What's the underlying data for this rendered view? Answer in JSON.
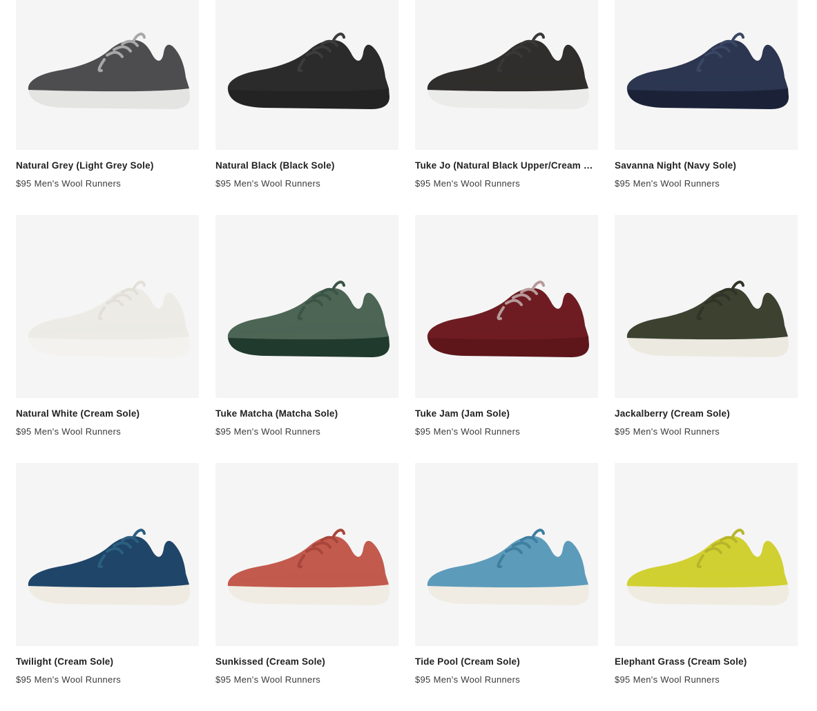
{
  "products": [
    {
      "name": "Natural Grey (Light Grey Sole)",
      "price": "$95",
      "line": "Men's Wool Runners",
      "upper": "#4d4d4f",
      "sole": "#e4e4e2",
      "lace": "#a8a8a8",
      "icon": "shoe-icon"
    },
    {
      "name": "Natural Black (Black Sole)",
      "price": "$95",
      "line": "Men's Wool Runners",
      "upper": "#2b2b2c",
      "sole": "#232323",
      "lace": "#3c3c3c",
      "icon": "shoe-icon"
    },
    {
      "name": "Tuke Jo (Natural Black Upper/Cream Sole)",
      "price": "$95",
      "line": "Men's Wool Runners",
      "upper": "#302e2c",
      "sole": "#ebebe9",
      "lace": "#3a3836",
      "icon": "shoe-icon"
    },
    {
      "name": "Savanna Night (Navy Sole)",
      "price": "$95",
      "line": "Men's Wool Runners",
      "upper": "#2c3650",
      "sole": "#1b2238",
      "lace": "#3a4663",
      "icon": "shoe-icon"
    },
    {
      "name": "Natural White (Cream Sole)",
      "price": "$95",
      "line": "Men's Wool Runners",
      "upper": "#ecebe6",
      "sole": "#f3f2ee",
      "lace": "#e1dfd8",
      "icon": "shoe-icon"
    },
    {
      "name": "Tuke Matcha (Matcha Sole)",
      "price": "$95",
      "line": "Men's Wool Runners",
      "upper": "#4c6555",
      "sole": "#213a2e",
      "lace": "#3a5446",
      "icon": "shoe-icon"
    },
    {
      "name": "Tuke Jam (Jam Sole)",
      "price": "$95",
      "line": "Men's Wool Runners",
      "upper": "#6e1c22",
      "sole": "#5e161b",
      "lace": "#b79a9a",
      "icon": "shoe-icon"
    },
    {
      "name": "Jackalberry (Cream Sole)",
      "price": "$95",
      "line": "Men's Wool Runners",
      "upper": "#3c4130",
      "sole": "#ece9e0",
      "lace": "#2f3427",
      "icon": "shoe-icon"
    },
    {
      "name": "Twilight (Cream Sole)",
      "price": "$95",
      "line": "Men's Wool Runners",
      "upper": "#1f4569",
      "sole": "#efebe2",
      "lace": "#2b5f80",
      "icon": "shoe-icon"
    },
    {
      "name": "Sunkissed (Cream Sole)",
      "price": "$95",
      "line": "Men's Wool Runners",
      "upper": "#c25a4d",
      "sole": "#f0ece3",
      "lace": "#a8463b",
      "icon": "shoe-icon"
    },
    {
      "name": "Tide Pool (Cream Sole)",
      "price": "$95",
      "line": "Men's Wool Runners",
      "upper": "#5d9bbb",
      "sole": "#f0ece3",
      "lace": "#3f7fa0",
      "icon": "shoe-icon"
    },
    {
      "name": "Elephant Grass (Cream Sole)",
      "price": "$95",
      "line": "Men's Wool Runners",
      "upper": "#d1d032",
      "sole": "#efebe0",
      "lace": "#b8b52a",
      "icon": "shoe-icon"
    }
  ]
}
